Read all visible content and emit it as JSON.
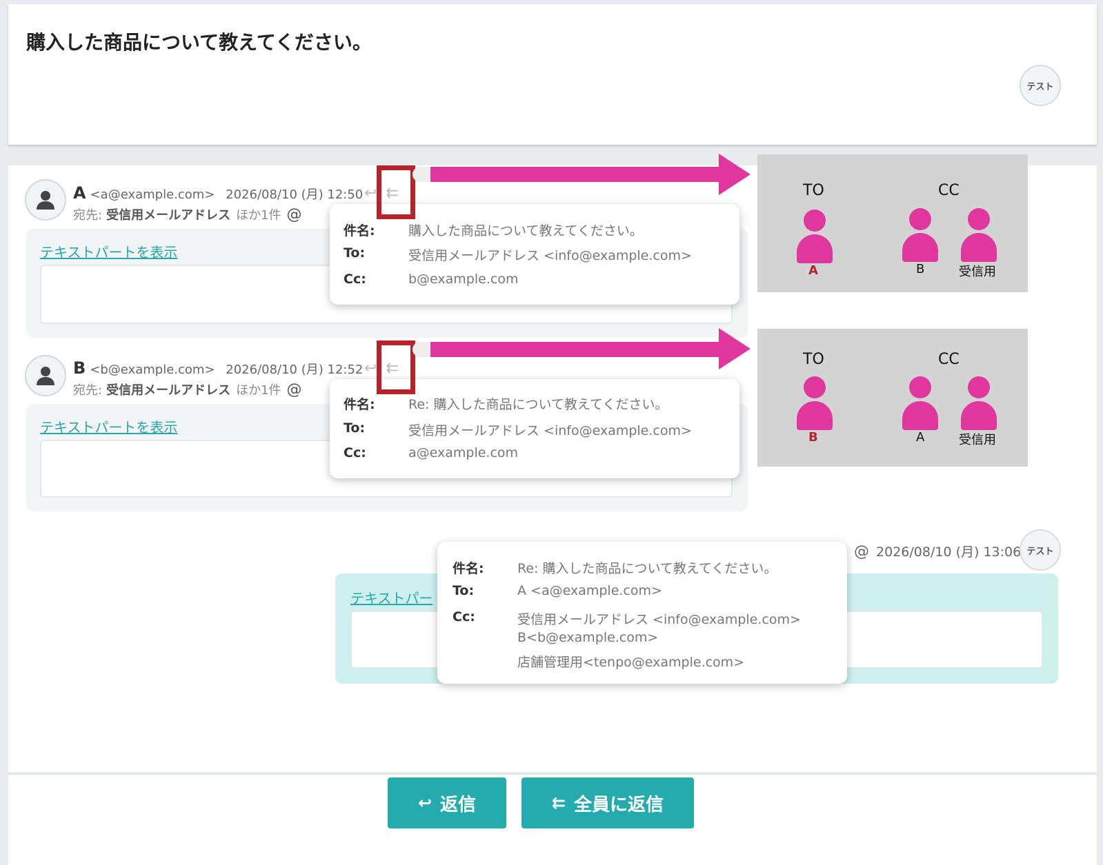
{
  "header": {
    "subject": "購入した商品について教えてください。",
    "avatar_label": "テスト"
  },
  "messages": [
    {
      "name": "A",
      "email": "<a@example.com>",
      "date": "2026/08/10 (月) 12:50",
      "to_prefix": "宛先:",
      "to_name": "受信用メールアドレス",
      "more": "ほか1件",
      "at": "@",
      "show_text": "テキストパートを表示",
      "popup": {
        "subject_label": "件名:",
        "subject": "購入した商品について教えてください。",
        "to_label": "To:",
        "to": "受信用メールアドレス <info@example.com>",
        "cc_label": "Cc:",
        "cc": "b@example.com"
      }
    },
    {
      "name": "B",
      "email": "<b@example.com>",
      "date": "2026/08/10 (月) 12:52",
      "to_prefix": "宛先:",
      "to_name": "受信用メールアドレス",
      "more": "ほか1件",
      "at": "@",
      "show_text": "テキストパートを表示",
      "popup": {
        "subject_label": "件名:",
        "subject": "Re: 購入した商品について教えてください。",
        "to_label": "To:",
        "to": "受信用メールアドレス <info@example.com>",
        "cc_label": "Cc:",
        "cc": "a@example.com"
      }
    }
  ],
  "own_message": {
    "at": "@",
    "date": "2026/08/10 (月) 13:06",
    "avatar_label": "テスト",
    "show_text": "テキストパー",
    "popup": {
      "subject_label": "件名:",
      "subject": "Re: 購入した商品について教えてください。",
      "to_label": "To:",
      "to": "A <a@example.com>",
      "cc_label": "Cc:",
      "cc_lines": [
        "受信用メールアドレス <info@example.com>",
        "B<b@example.com>",
        "店舗管理用<tenpo@example.com>"
      ]
    }
  },
  "diagrams": [
    {
      "to_header": "TO",
      "cc_header": "CC",
      "to_person": "A",
      "cc_persons": [
        "B",
        "受信用"
      ]
    },
    {
      "to_header": "TO",
      "cc_header": "CC",
      "to_person": "B",
      "cc_persons": [
        "A",
        "受信用"
      ]
    }
  ],
  "reply_icons": {
    "reply": "↩",
    "reply_all": "⇇"
  },
  "footer": {
    "reply_label": "返信",
    "reply_all_label": "全員に返信"
  },
  "colors": {
    "accent": "#24abad",
    "highlight": "#e0379e",
    "frame": "#b8232a"
  }
}
